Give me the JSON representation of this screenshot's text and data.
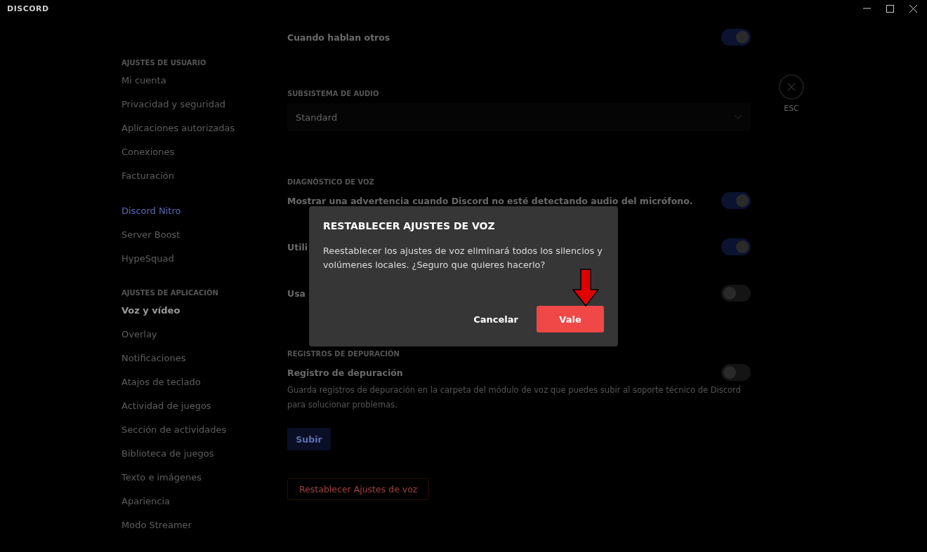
{
  "window": {
    "logo": "DISCORD"
  },
  "sidebar": {
    "groups": [
      {
        "label": "AJUSTES DE USUARIO",
        "items": [
          {
            "label": "Mi cuenta",
            "selected": false
          },
          {
            "label": "Privacidad y seguridad",
            "selected": false
          },
          {
            "label": "Aplicaciones autorizadas",
            "selected": false
          },
          {
            "label": "Conexiones",
            "selected": false
          },
          {
            "label": "Facturación",
            "selected": false
          }
        ]
      },
      {
        "items": [
          {
            "label": "Discord Nitro",
            "selected": false,
            "color": "#5a6ab8"
          },
          {
            "label": "Server Boost",
            "selected": false
          },
          {
            "label": "HypeSquad",
            "selected": false
          }
        ]
      },
      {
        "label": "AJUSTES DE APLICACIÓN",
        "items": [
          {
            "label": "Voz y vídeo",
            "selected": true
          },
          {
            "label": "Overlay",
            "selected": false
          },
          {
            "label": "Notificaciones",
            "selected": false
          },
          {
            "label": "Atajos de teclado",
            "selected": false
          },
          {
            "label": "Actividad de juegos",
            "selected": false
          },
          {
            "label": "Sección de actividades",
            "selected": false
          },
          {
            "label": "Biblioteca de juegos",
            "selected": false
          },
          {
            "label": "Texto e imágenes",
            "selected": false
          },
          {
            "label": "Apariencia",
            "selected": false
          },
          {
            "label": "Modo Streamer",
            "selected": false
          }
        ]
      }
    ]
  },
  "content": {
    "sections": [
      {
        "rows": [
          {
            "label": "Cuando hablan otros",
            "on": true
          }
        ]
      },
      {
        "label": "SUBSISTEMA DE AUDIO",
        "select": {
          "value": "Standard"
        }
      },
      {
        "label": "DIAGNÓSTICO DE VOZ",
        "rows": [
          {
            "label": "Mostrar una advertencia cuando Discord no esté detectando audio del micrófono.",
            "on": true
          },
          {
            "label": "Utili",
            "on": true
          },
          {
            "label": "Usa",
            "on": false
          }
        ]
      },
      {
        "label": "REGISTROS DE DEPURACIÓN",
        "rows": [
          {
            "label": "Registro de depuración",
            "on": false,
            "description": "Guarda registros de depuración en la carpeta del módulo de voz que puedes subir al soporte técnico de Discord para solucionar problemas."
          }
        ],
        "button": "Subir"
      }
    ],
    "reset_button": "Restablecer Ajustes de voz"
  },
  "close": {
    "label": "ESC"
  },
  "dialog": {
    "title": "RESTABLECER AJUSTES DE VOZ",
    "body": "Reestablecer los ajustes de voz eliminará todos los silencios y volúmenes locales. ¿Seguro que quieres hacerlo?",
    "cancel": "Cancelar",
    "confirm": "Vale"
  }
}
